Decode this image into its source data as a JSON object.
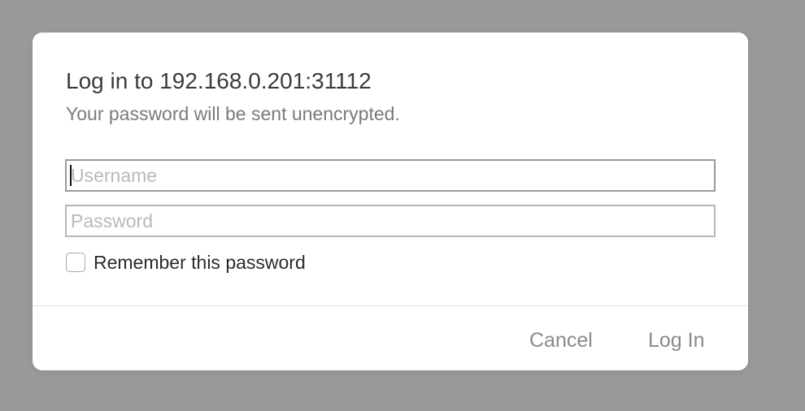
{
  "dialog": {
    "title": "Log in to 192.168.0.201:31112",
    "subtitle": "Your password will be sent unencrypted.",
    "username_placeholder": "Username",
    "password_placeholder": "Password",
    "remember_label": "Remember this password",
    "remember_checked": false,
    "cancel_label": "Cancel",
    "login_label": "Log In"
  },
  "colors": {
    "backdrop": "#999999",
    "dialog": "#ffffff",
    "button_text": "#8a8a8a"
  }
}
